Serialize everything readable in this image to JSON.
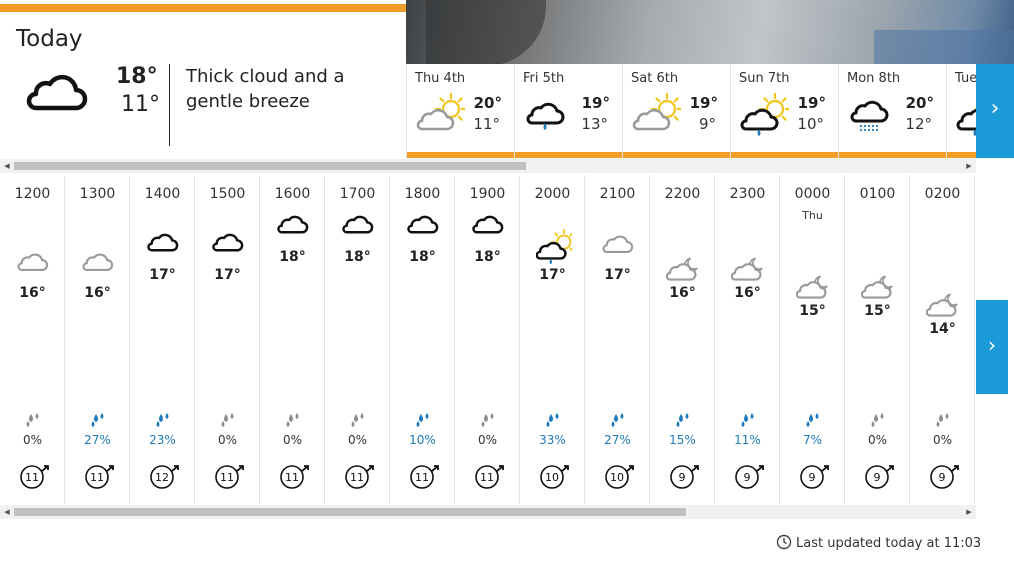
{
  "today": {
    "label": "Today",
    "high": "18°",
    "low": "11°",
    "description": "Thick cloud and a gentle breeze",
    "icon": "thick-cloud-icon"
  },
  "days": [
    {
      "label": "Thu 4th",
      "high": "20°",
      "low": "11°",
      "icon": "sun-cloud-icon"
    },
    {
      "label": "Fri 5th",
      "high": "19°",
      "low": "13°",
      "icon": "cloud-rain-icon"
    },
    {
      "label": "Sat 6th",
      "high": "19°",
      "low": "9°",
      "icon": "sun-cloud-icon"
    },
    {
      "label": "Sun 7th",
      "high": "19°",
      "low": "10°",
      "icon": "sun-cloud-rain-icon"
    },
    {
      "label": "Mon 8th",
      "high": "20°",
      "low": "12°",
      "icon": "cloud-drizzle-icon"
    },
    {
      "label": "Tue",
      "high": "",
      "low": "",
      "icon": "sun-cloud-rain-icon"
    }
  ],
  "hours": [
    {
      "time": "1200",
      "day": "",
      "temp": "16°",
      "rain": "0%",
      "wind": "11",
      "icon": "light-cloud-icon",
      "level": 1
    },
    {
      "time": "1300",
      "day": "",
      "temp": "16°",
      "rain": "27%",
      "wind": "11",
      "icon": "light-cloud-icon",
      "level": 1
    },
    {
      "time": "1400",
      "day": "",
      "temp": "17°",
      "rain": "23%",
      "wind": "12",
      "icon": "thick-cloud-icon",
      "level": 2
    },
    {
      "time": "1500",
      "day": "",
      "temp": "17°",
      "rain": "0%",
      "wind": "11",
      "icon": "thick-cloud-icon",
      "level": 2
    },
    {
      "time": "1600",
      "day": "",
      "temp": "18°",
      "rain": "0%",
      "wind": "11",
      "icon": "thick-cloud-icon",
      "level": 3
    },
    {
      "time": "1700",
      "day": "",
      "temp": "18°",
      "rain": "0%",
      "wind": "11",
      "icon": "thick-cloud-icon",
      "level": 3
    },
    {
      "time": "1800",
      "day": "",
      "temp": "18°",
      "rain": "10%",
      "wind": "11",
      "icon": "thick-cloud-icon",
      "level": 3
    },
    {
      "time": "1900",
      "day": "",
      "temp": "18°",
      "rain": "0%",
      "wind": "11",
      "icon": "thick-cloud-icon",
      "level": 3
    },
    {
      "time": "2000",
      "day": "",
      "temp": "17°",
      "rain": "33%",
      "wind": "10",
      "icon": "sun-cloud-rain-icon",
      "level": 2
    },
    {
      "time": "2100",
      "day": "",
      "temp": "17°",
      "rain": "27%",
      "wind": "10",
      "icon": "light-cloud-icon",
      "level": 2
    },
    {
      "time": "2200",
      "day": "",
      "temp": "16°",
      "rain": "15%",
      "wind": "9",
      "icon": "moon-cloud-icon",
      "level": 1
    },
    {
      "time": "2300",
      "day": "",
      "temp": "16°",
      "rain": "11%",
      "wind": "9",
      "icon": "moon-cloud-icon",
      "level": 1
    },
    {
      "time": "0000",
      "day": "Thu",
      "temp": "15°",
      "rain": "7%",
      "wind": "9",
      "icon": "moon-cloud-icon",
      "level": 0
    },
    {
      "time": "0100",
      "day": "",
      "temp": "15°",
      "rain": "0%",
      "wind": "9",
      "icon": "moon-cloud-icon",
      "level": 0
    },
    {
      "time": "0200",
      "day": "",
      "temp": "14°",
      "rain": "0%",
      "wind": "9",
      "icon": "moon-cloud-icon",
      "level": -1
    }
  ],
  "footer": {
    "last_updated": "Last updated today at 11:03",
    "icon": "clock-icon"
  },
  "colors": {
    "accent_orange": "#f29d28",
    "nav_blue": "#1a9ad6",
    "rain_blue": "#1f7ab8",
    "sun_yellow": "#f3c51a"
  }
}
